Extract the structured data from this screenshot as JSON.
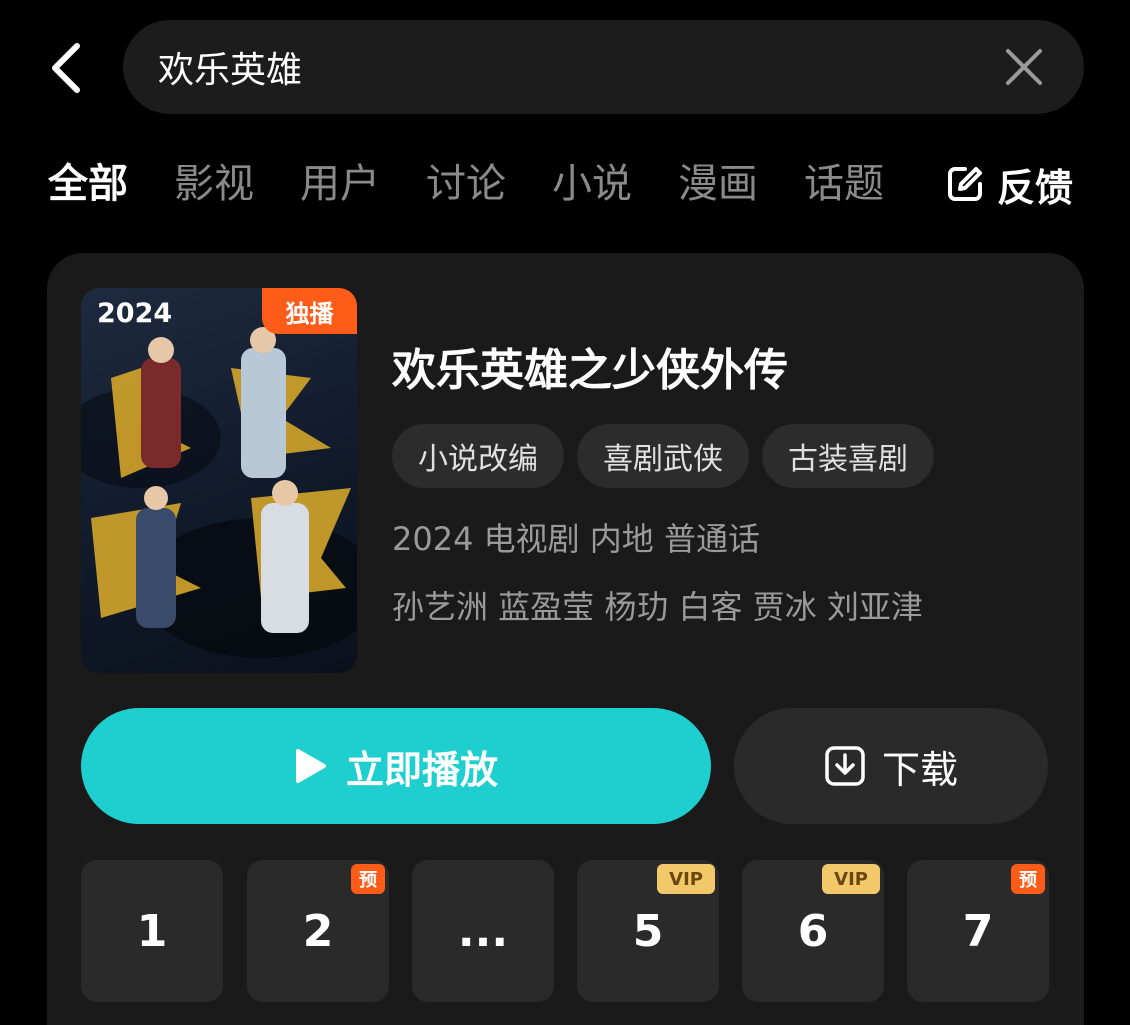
{
  "search": {
    "query": "欢乐英雄"
  },
  "tabs": [
    {
      "label": "全部",
      "active": true
    },
    {
      "label": "影视",
      "active": false
    },
    {
      "label": "用户",
      "active": false
    },
    {
      "label": "讨论",
      "active": false
    },
    {
      "label": "小说",
      "active": false
    },
    {
      "label": "漫画",
      "active": false
    },
    {
      "label": "话题",
      "active": false
    }
  ],
  "feedback": {
    "label": "反馈",
    "icon": "edit-icon"
  },
  "result": {
    "poster": {
      "year": "2024",
      "badge": "独播"
    },
    "title": "欢乐英雄之少侠外传",
    "tags": [
      "小说改编",
      "喜剧武侠",
      "古装喜剧"
    ],
    "meta_line1": "2024 电视剧 内地 普通话",
    "meta_line2": "孙艺洲 蓝盈莹 杨玏 白客 贾冰 刘亚津",
    "play_label": "立即播放",
    "download_label": "下载"
  },
  "episodes": [
    {
      "label": "1",
      "badge": ""
    },
    {
      "label": "2",
      "badge": "预"
    },
    {
      "label": "...",
      "badge": ""
    },
    {
      "label": "5",
      "badge": "VIP"
    },
    {
      "label": "6",
      "badge": "VIP"
    },
    {
      "label": "7",
      "badge": "预"
    }
  ],
  "colors": {
    "accent": "#1fcfcf",
    "background": "#000000",
    "card": "#1a1a1a",
    "exclusive_badge": "#ff5c1a",
    "vip_badge": "#f3c86a"
  }
}
